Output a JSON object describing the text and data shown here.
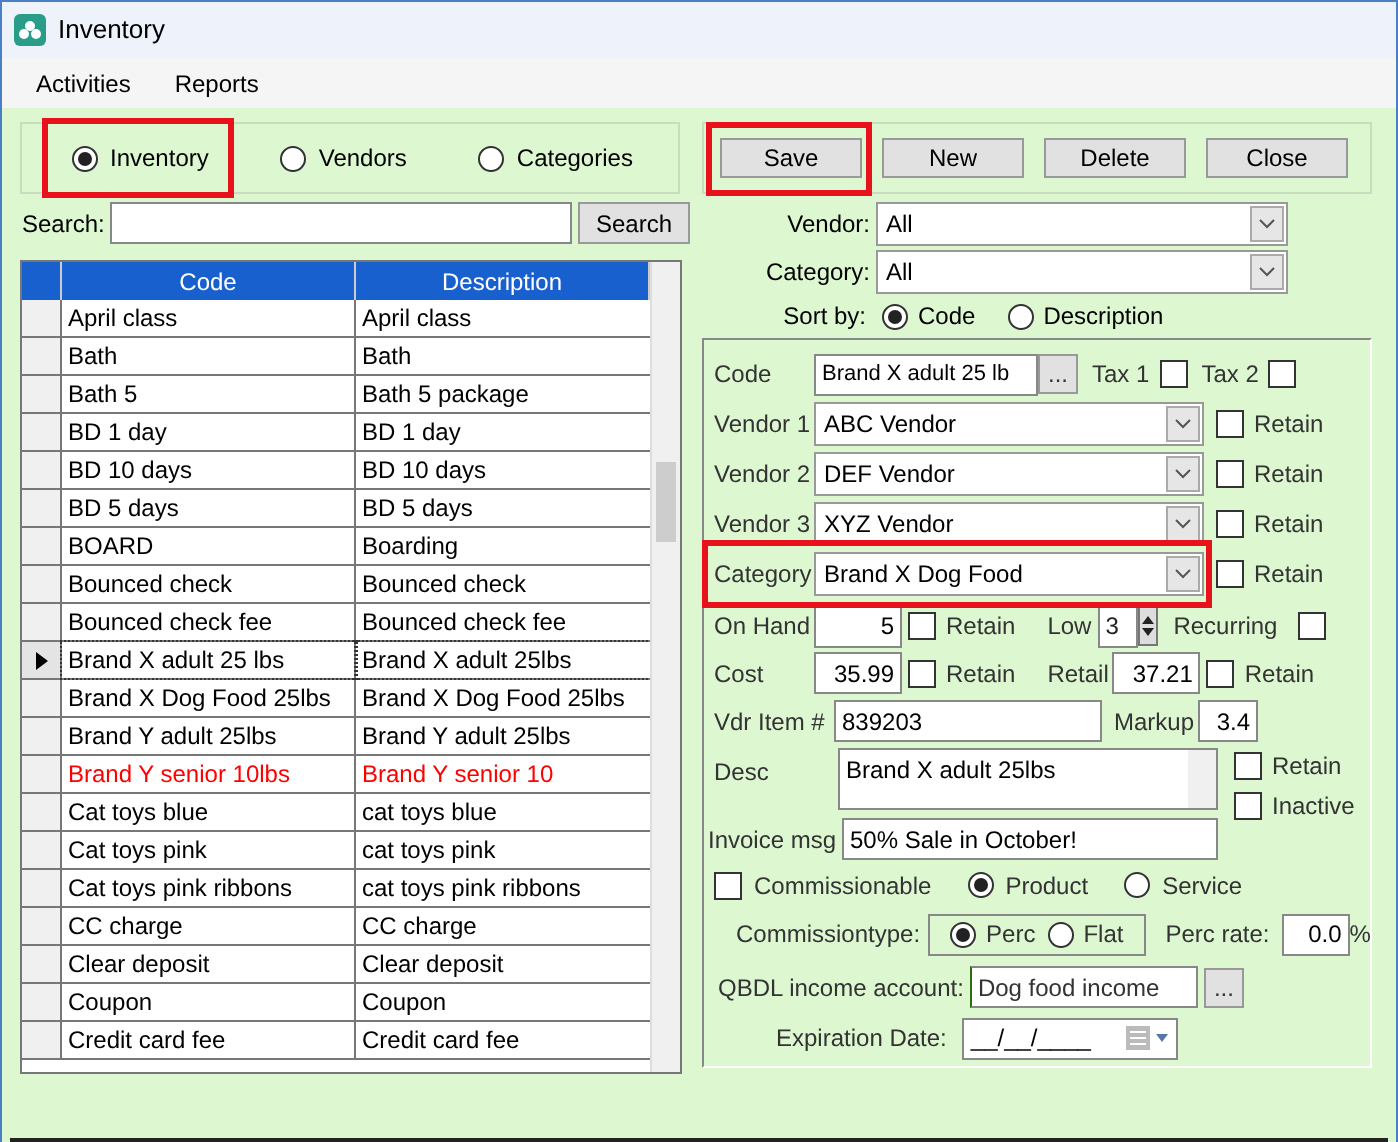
{
  "window": {
    "title": "Inventory"
  },
  "menu": [
    "Activities",
    "Reports"
  ],
  "list_type": [
    {
      "label": "Inventory",
      "selected": true,
      "highlighted": true
    },
    {
      "label": "Vendors",
      "selected": false,
      "highlighted": false
    },
    {
      "label": "Categories",
      "selected": false,
      "highlighted": false
    }
  ],
  "search": {
    "label": "Search:",
    "button": "Search"
  },
  "table": {
    "columns": [
      "Code",
      "Description"
    ],
    "rows": [
      {
        "code": "April class",
        "description": "April class",
        "selected": false,
        "color": "#000000"
      },
      {
        "code": "Bath",
        "description": "Bath",
        "selected": false,
        "color": "#000000"
      },
      {
        "code": "Bath 5",
        "description": "Bath 5 package",
        "selected": false,
        "color": "#000000"
      },
      {
        "code": "BD 1 day",
        "description": "BD 1 day",
        "selected": false,
        "color": "#000000"
      },
      {
        "code": "BD 10 days",
        "description": "BD 10 days",
        "selected": false,
        "color": "#000000"
      },
      {
        "code": "BD 5 days",
        "description": "BD 5 days",
        "selected": false,
        "color": "#000000"
      },
      {
        "code": "BOARD",
        "description": "Boarding",
        "selected": false,
        "color": "#000000"
      },
      {
        "code": "Bounced check",
        "description": "Bounced check",
        "selected": false,
        "color": "#000000"
      },
      {
        "code": "Bounced check fee",
        "description": "Bounced check fee",
        "selected": false,
        "color": "#000000"
      },
      {
        "code": "Brand X adult 25 lbs",
        "description": "Brand X adult 25lbs",
        "selected": true,
        "color": "#000000"
      },
      {
        "code": "Brand X Dog Food 25lbs",
        "description": "Brand X Dog Food 25lbs",
        "selected": false,
        "color": "#000000"
      },
      {
        "code": "Brand Y adult 25lbs",
        "description": "Brand Y adult 25lbs",
        "selected": false,
        "color": "#000000"
      },
      {
        "code": "Brand Y senior 10lbs",
        "description": "Brand Y senior 10",
        "selected": false,
        "color": "#ff0000"
      },
      {
        "code": "Cat toys blue",
        "description": "cat toys blue",
        "selected": false,
        "color": "#000000"
      },
      {
        "code": "Cat toys pink",
        "description": "cat toys pink",
        "selected": false,
        "color": "#000000"
      },
      {
        "code": "Cat toys pink ribbons",
        "description": "cat toys pink ribbons",
        "selected": false,
        "color": "#000000"
      },
      {
        "code": "CC charge",
        "description": "CC charge",
        "selected": false,
        "color": "#000000"
      },
      {
        "code": "Clear deposit",
        "description": "Clear deposit",
        "selected": false,
        "color": "#000000"
      },
      {
        "code": "Coupon",
        "description": "Coupon",
        "selected": false,
        "color": "#000000"
      },
      {
        "code": "Credit card fee",
        "description": "Credit card fee",
        "selected": false,
        "color": "#000000"
      }
    ]
  },
  "actions": [
    {
      "label": "Save",
      "highlighted": true
    },
    {
      "label": "New",
      "highlighted": false
    },
    {
      "label": "Delete",
      "highlighted": false
    },
    {
      "label": "Close",
      "highlighted": false
    }
  ],
  "filters": [
    {
      "label": "Vendor:",
      "value": "All"
    },
    {
      "label": "Category:",
      "value": "All"
    }
  ],
  "sort": {
    "label": "Sort by:",
    "options": [
      {
        "label": "Code",
        "selected": true
      },
      {
        "label": "Description",
        "selected": false
      }
    ]
  },
  "form": {
    "code": {
      "label": "Code",
      "value": "Brand X adult 25 lb",
      "button": "..."
    },
    "taxes": [
      {
        "label": "Tax 1",
        "checked": false
      },
      {
        "label": "Tax 2",
        "checked": false
      }
    ],
    "vendors": [
      {
        "label": "Vendor 1",
        "value": "ABC Vendor",
        "retain_label": "Retain",
        "retain": false
      },
      {
        "label": "Vendor 2",
        "value": "DEF Vendor",
        "retain_label": "Retain",
        "retain": false
      },
      {
        "label": "Vendor 3",
        "value": "XYZ Vendor",
        "retain_label": "Retain",
        "retain": false
      }
    ],
    "category": {
      "label": "Category",
      "value": "Brand X Dog Food",
      "retain_label": "Retain",
      "retain": false,
      "highlighted": true
    },
    "on_hand": {
      "label": "On Hand",
      "value": "5",
      "retain_label": "Retain",
      "retain": false
    },
    "low": {
      "label": "Low",
      "value": "3"
    },
    "recurring": {
      "label": "Recurring",
      "checked": false
    },
    "cost": {
      "label": "Cost",
      "value": "35.99",
      "retain_label": "Retain",
      "retain": false
    },
    "retail": {
      "label": "Retail",
      "value": "37.21",
      "retain_label": "Retain",
      "retain": false
    },
    "vdr_item": {
      "label": "Vdr Item #",
      "value": "839203"
    },
    "markup": {
      "label": "Markup",
      "value": "3.4"
    },
    "desc": {
      "label": "Desc",
      "value": "Brand X adult 25lbs",
      "retain_label": "Retain",
      "retain": false,
      "inactive_label": "Inactive",
      "inactive": false
    },
    "invoice_msg": {
      "label": "Invoice msg",
      "value": "50% Sale in October!"
    },
    "commissionable": {
      "label": "Commissionable",
      "checked": false
    },
    "item_type": [
      {
        "label": "Product",
        "selected": true
      },
      {
        "label": "Service",
        "selected": false
      }
    ],
    "commission_type": {
      "label": "Commissiontype:",
      "options": [
        {
          "label": "Perc",
          "selected": true
        },
        {
          "label": "Flat",
          "selected": false
        }
      ]
    },
    "perc_rate": {
      "label": "Perc rate:",
      "value": "0.0",
      "unit": "%"
    },
    "qbdl": {
      "label": "QBDL income account:",
      "value": "Dog food income",
      "button": "..."
    },
    "expiration": {
      "label": "Expiration Date:",
      "value": "__/__/____"
    }
  }
}
